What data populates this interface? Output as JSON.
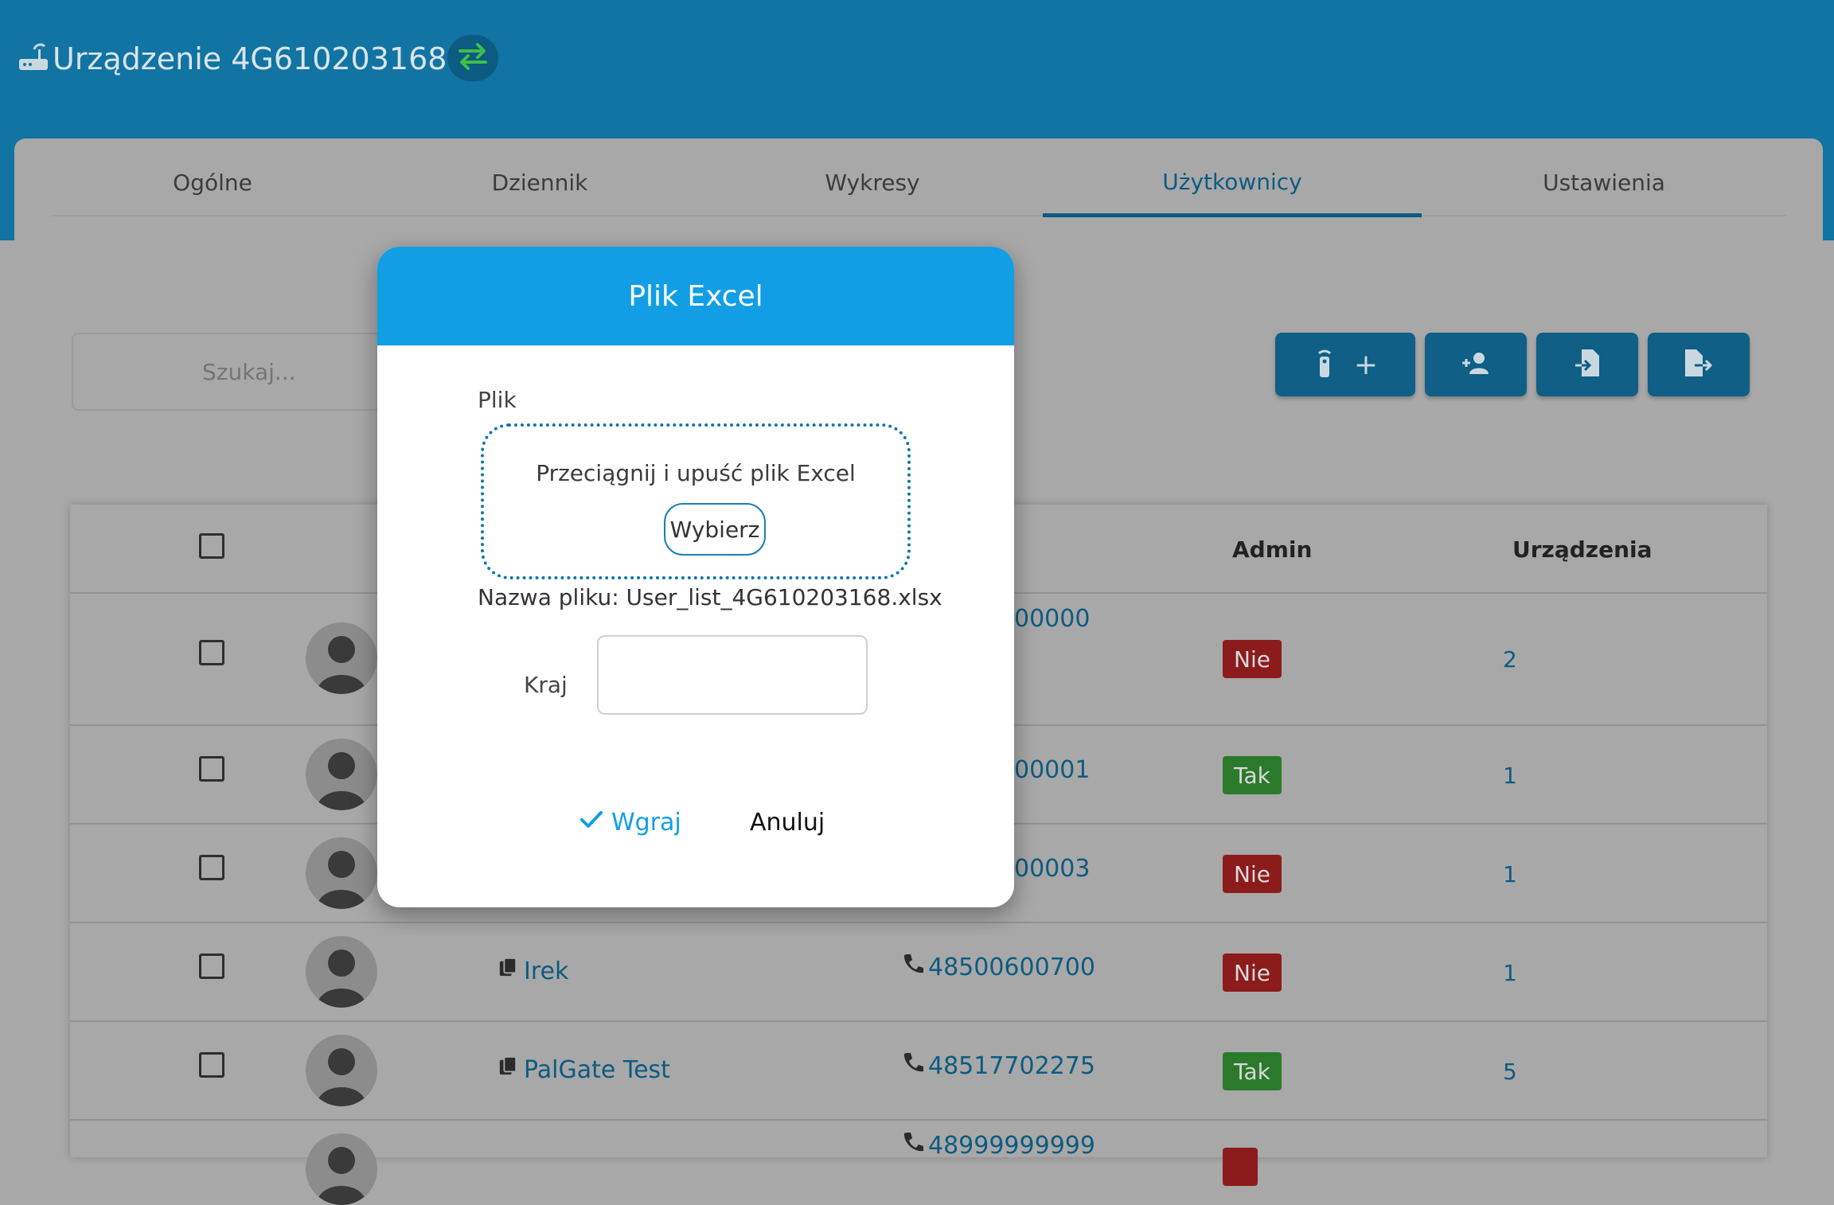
{
  "header": {
    "title": "Urządzenie 4G610203168"
  },
  "tabs": [
    {
      "label": "Ogólne"
    },
    {
      "label": "Dziennik"
    },
    {
      "label": "Wykresy"
    },
    {
      "label": "Użytkownicy"
    },
    {
      "label": "Ustawienia"
    }
  ],
  "active_tab": "Użytkownicy",
  "search": {
    "placeholder": "Szukaj..."
  },
  "toolbar": {
    "add_remote_plus": "+"
  },
  "table": {
    "headers": {
      "admin": "Admin",
      "devices": "Urządzenia"
    },
    "rows": [
      {
        "name": "",
        "phone": "00000",
        "admin": "Nie",
        "devices": "2"
      },
      {
        "name": "",
        "phone": "00001",
        "admin": "Tak",
        "devices": "1"
      },
      {
        "name": "",
        "phone": "00003",
        "admin": "Nie",
        "devices": "1"
      },
      {
        "name": "Irek",
        "phone": "48500600700",
        "admin": "Nie",
        "devices": "1"
      },
      {
        "name": "PalGate Test",
        "phone": "48517702275",
        "admin": "Tak",
        "devices": "5"
      },
      {
        "name": "",
        "phone": "48999999999",
        "admin": "",
        "devices": ""
      }
    ]
  },
  "modal": {
    "title": "Plik Excel",
    "file_label": "Plik",
    "drop_text": "Przeciągnij i upuść plik Excel",
    "choose_label": "Wybierz",
    "filename_text": "Nazwa pliku: User_list_4G610203168.xlsx",
    "country_label": "Kraj",
    "country_value": "",
    "upload_label": "Wgraj",
    "cancel_label": "Anuluj"
  },
  "colors": {
    "header_bg": "#1174a3",
    "modal_header": "#119ee4",
    "link": "#0d5b82",
    "badge_no": "#8c1b1b",
    "badge_yes": "#2b7a2b"
  }
}
